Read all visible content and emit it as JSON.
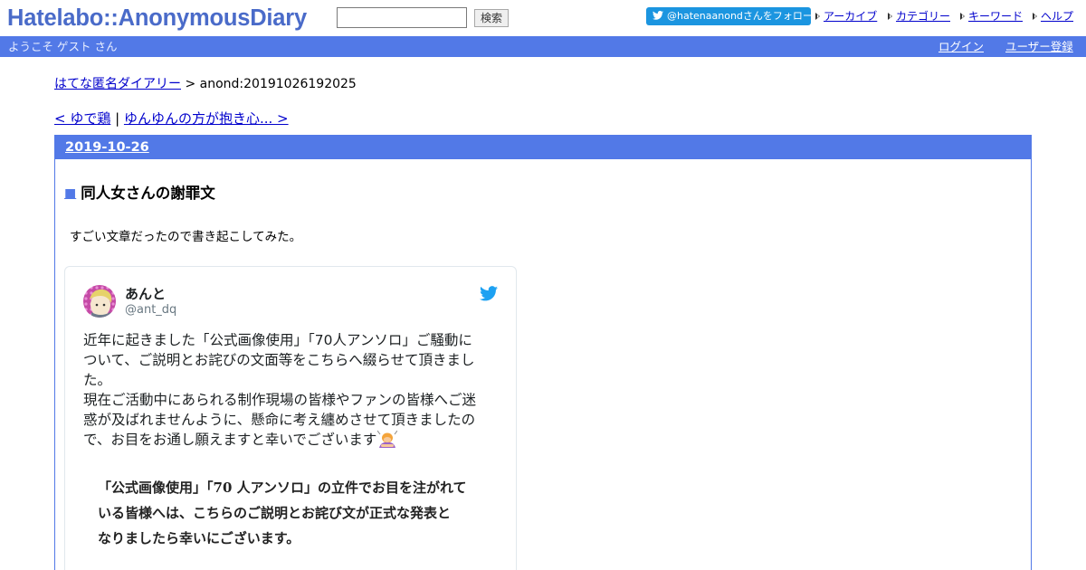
{
  "header": {
    "logo": "Hatelabo::AnonymousDiary",
    "search_value": "",
    "search_button": "検索",
    "twitter_follow": "@hatenaanondさんをフォロー",
    "nav": [
      {
        "label": "アーカイブ"
      },
      {
        "label": "カテゴリー"
      },
      {
        "label": "キーワード"
      },
      {
        "label": "ヘルプ"
      }
    ]
  },
  "welcome_bar": {
    "text": "ようこそ ゲスト さん",
    "login": "ログイン",
    "register": "ユーザー登録"
  },
  "breadcrumb": {
    "home": "はてな匿名ダイアリー",
    "separator": " > ",
    "current": "anond:20191026192025"
  },
  "pager": {
    "prev": "< ゆで鶏",
    "separator": " | ",
    "next": "ゆんゆんの方が抱き心... >"
  },
  "day": {
    "date": "2019-10-26",
    "entry": {
      "marker": "■",
      "title": "同人女さんの謝罪文",
      "body": "すごい文章だったので書き起こしてみた。"
    }
  },
  "tweet": {
    "name": "あんと",
    "handle": "@ant_dq",
    "lines": [
      "近年に起きました「公式画像使用」「70人アンソロ」ご騒動に",
      "ついて、ご説明とお詫びの文面等をこちらへ綴らせて頂きまし",
      "た。",
      "現在ご活動中にあられる制作現場の皆様やファンの皆様へご迷",
      "惑が及ばれませんように、懸命に考え纏めさせて頂きましたの",
      "で、お目をお通し願えますと幸いでございます"
    ],
    "image_lines": [
      "「公式画像使用」「70 人アンソロ」の立件でお目を注がれて",
      "いる皆様へは、こちらのご説明とお詫び文が正式な発表と",
      "なりましたら幸いにございます。"
    ]
  },
  "colors": {
    "brand_blue": "#5279e7",
    "logo_blue": "#4a6bc9",
    "twitter_blue": "#1da1f2",
    "link": "#0000cc"
  }
}
